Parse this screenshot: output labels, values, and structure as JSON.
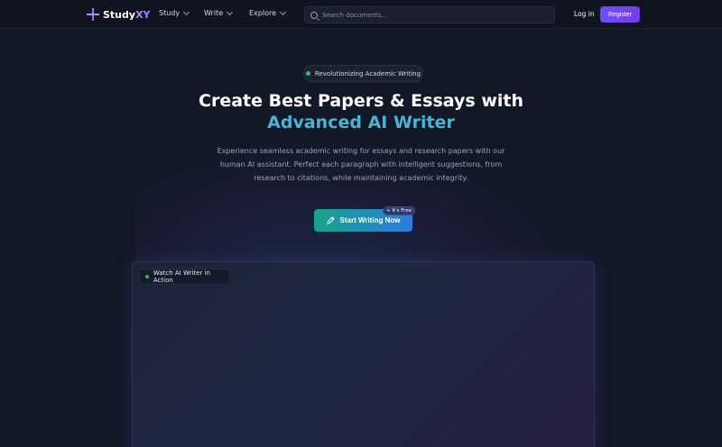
{
  "nav": {
    "logo_main": "Study",
    "logo_accent": "XY",
    "menu": [
      {
        "label": "Study"
      },
      {
        "label": "Write"
      },
      {
        "label": "Explore"
      }
    ],
    "search_placeholder": "Search documents...",
    "login_label": "Log in",
    "register_label": "Register"
  },
  "hero": {
    "badge": "Revolutionizing Academic Writing",
    "title_line1": "Create Best Papers & Essays with",
    "title_line2": "Advanced AI Writer",
    "subtitle": "Experience seamless academic writing for essays and research papers with our human AI assistant. Perfect each paragraph with intelligent suggestions, from research to citations, while maintaining academic integrity.",
    "cta_label": "Start Writing Now",
    "free_badge": "+ It's Free"
  },
  "video": {
    "label": "Watch AI Writer in Action"
  },
  "colors": {
    "background": "#121826",
    "accent_purple": "#7c3aed",
    "accent_cyan": "#46b6d6",
    "status_green": "#22c55e"
  }
}
